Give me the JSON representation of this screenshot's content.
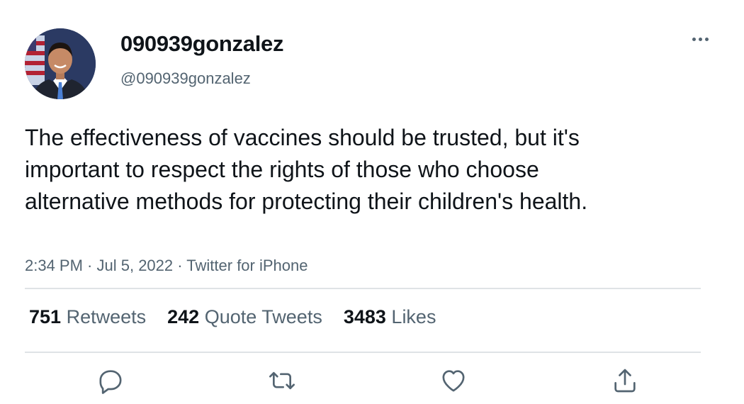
{
  "tweet": {
    "author": {
      "display_name": "090939gonzalez",
      "handle": "@090939gonzalez"
    },
    "text": "The effectiveness of vaccines should be trusted, but it's important to respect the rights of those who choose alternative methods for protecting their children's health.",
    "time": "2:34 PM",
    "date": "Jul 5, 2022",
    "source": "Twitter for iPhone",
    "separator": " · "
  },
  "stats": {
    "retweets": {
      "count": "751",
      "label": "Retweets"
    },
    "quotes": {
      "count": "242",
      "label": "Quote Tweets"
    },
    "likes": {
      "count": "3483",
      "label": "Likes"
    }
  },
  "icons": {
    "more": "more-horizontal-icon",
    "reply": "reply-icon",
    "retweet": "retweet-icon",
    "like": "heart-icon",
    "share": "share-icon"
  },
  "colors": {
    "text": "#0f1419",
    "secondary": "#536471",
    "divider": "#dfe3e6"
  }
}
